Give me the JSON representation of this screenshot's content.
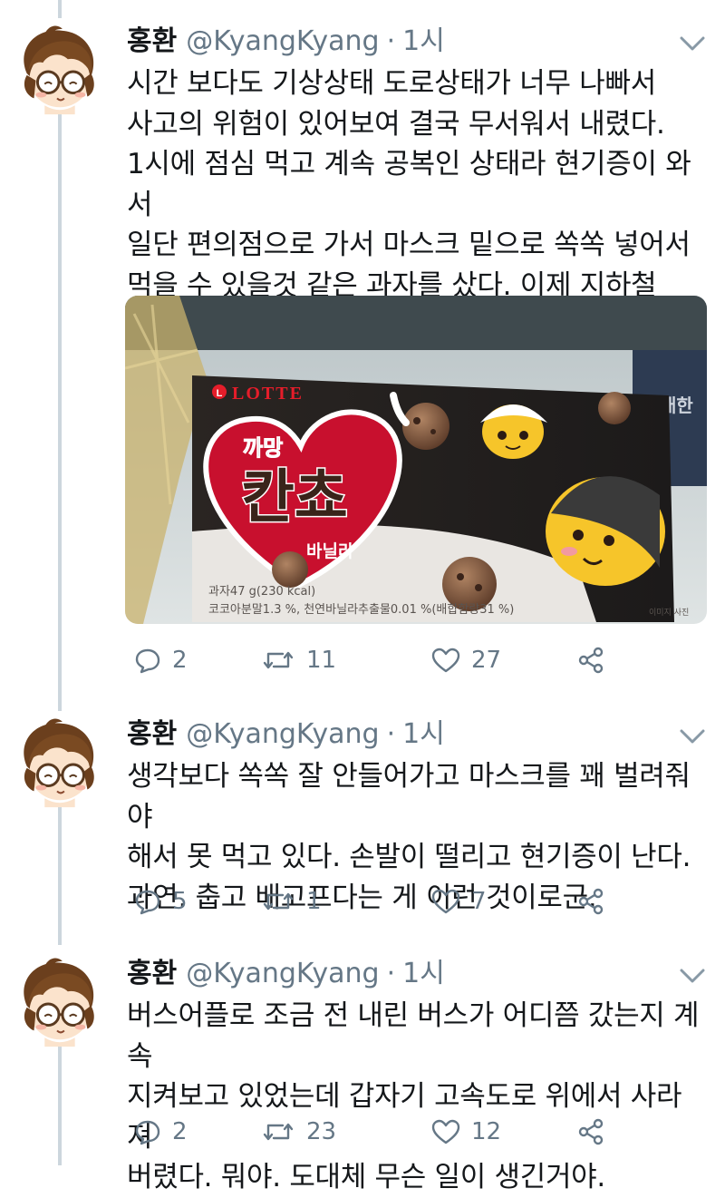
{
  "colors": {
    "muted": "#657786",
    "text": "#14171a",
    "thread": "#ccd6dd",
    "package_red": "#c8102e"
  },
  "tweets": [
    {
      "name": "홍환",
      "handle": "@KyangKyang",
      "dot": "·",
      "time": "1시",
      "text": "시간 보다도 기상상태 도로상태가 너무 나빠서\n사고의 위험이 있어보여 결국 무서워서 내렸다.\n1시에 점심 먹고 계속 공복인 상태라 현기증이 와서\n일단 편의점으로 가서 마스크 밑으로 쏙쏙 넣어서\n먹을 수 있을것 같은 과자를 샀다. 이제 지하철\n천리행 시작이다.",
      "replies": "2",
      "retweets": "11",
      "likes": "27",
      "photo": {
        "brand": "LOTTE",
        "product_top": "까망",
        "product_name": "칸쵸",
        "flavor": "바닐라",
        "nutrition_line1": "과자47 g(230 kcal)",
        "nutrition_line2": "코코아분말1.3 %, 천연바닐라추출물0.01 %(배합함량31 %)",
        "corner_note": "이미지 사진",
        "bg_text": "대한"
      }
    },
    {
      "name": "홍환",
      "handle": "@KyangKyang",
      "dot": "·",
      "time": "1시",
      "text": "생각보다 쏙쏙 잘 안들어가고 마스크를 꽤 벌려줘야\n해서 못 먹고 있다. 손발이 떨리고 현기증이 난다.\n과연. 춥고 배고프다는 게 이런 것이로군.",
      "replies": "5",
      "retweets": "1",
      "likes": "7"
    },
    {
      "name": "홍환",
      "handle": "@KyangKyang",
      "dot": "·",
      "time": "1시",
      "text": "버스어플로 조금 전 내린 버스가 어디쯤 갔는지 계속\n지켜보고 있었는데 갑자기 고속도로 위에서 사라져\n버렸다. 뭐야. 도대체 무슨 일이 생긴거야.",
      "replies": "2",
      "retweets": "23",
      "likes": "12"
    }
  ]
}
